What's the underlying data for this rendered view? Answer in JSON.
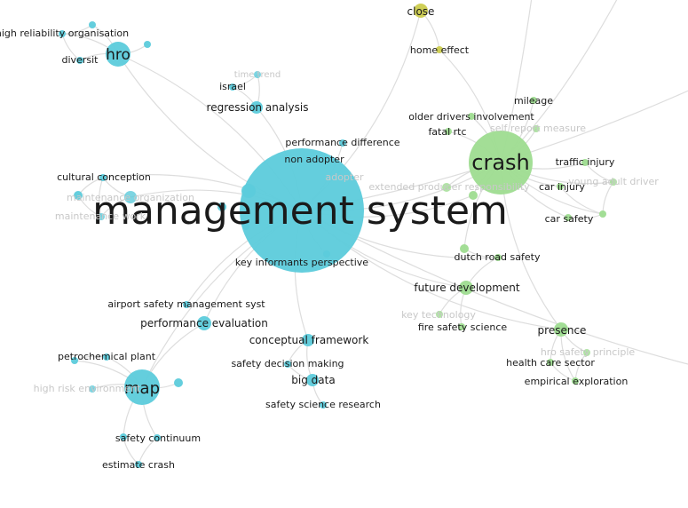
{
  "colors": {
    "cluster_cyan": "#5ccbdb",
    "cluster_green": "#9edc90",
    "cluster_yellow": "#cccc4e",
    "edge": "#dddddd",
    "label": "#1a1a1a",
    "label_faded": "#c8c8c8"
  },
  "nodes": [
    {
      "label": "management system",
      "cluster": "cyan"
    },
    {
      "label": "hro",
      "cluster": "cyan"
    },
    {
      "label": "high reliability organisation",
      "cluster": "cyan"
    },
    {
      "label": "",
      "cluster": "cyan"
    },
    {
      "label": "",
      "cluster": "cyan"
    },
    {
      "label": "diversit",
      "cluster": "cyan"
    },
    {
      "label": "time trend",
      "cluster": "cyan",
      "faded": true
    },
    {
      "label": "israel",
      "cluster": "cyan"
    },
    {
      "label": "regression analysis",
      "cluster": "cyan"
    },
    {
      "label": "performance difference",
      "cluster": "cyan"
    },
    {
      "label": "non adopter",
      "cluster": "cyan"
    },
    {
      "label": "adopter",
      "cluster": "cyan",
      "faded": true
    },
    {
      "label": "cultural conception",
      "cluster": "cyan"
    },
    {
      "label": "maintenance organization",
      "cluster": "cyan",
      "faded": true
    },
    {
      "label": "",
      "cluster": "cyan"
    },
    {
      "label": "maintenance work",
      "cluster": "cyan",
      "faded": true
    },
    {
      "label": "key informants perspective",
      "cluster": "cyan"
    },
    {
      "label": "",
      "cluster": "cyan"
    },
    {
      "label": "",
      "cluster": "cyan"
    },
    {
      "label": "",
      "cluster": "cyan"
    },
    {
      "label": "airport safety management syst",
      "cluster": "cyan"
    },
    {
      "label": "performance evaluation",
      "cluster": "cyan"
    },
    {
      "label": "conceptual framework",
      "cluster": "cyan"
    },
    {
      "label": "safety decision making",
      "cluster": "cyan"
    },
    {
      "label": "big data",
      "cluster": "cyan"
    },
    {
      "label": "safety science research",
      "cluster": "cyan"
    },
    {
      "label": "map",
      "cluster": "cyan"
    },
    {
      "label": "petrochemical plant",
      "cluster": "cyan"
    },
    {
      "label": "",
      "cluster": "cyan"
    },
    {
      "label": "",
      "cluster": "cyan"
    },
    {
      "label": "high risk environment",
      "cluster": "cyan",
      "faded": true
    },
    {
      "label": "safety continuum",
      "cluster": "cyan"
    },
    {
      "label": "",
      "cluster": "cyan"
    },
    {
      "label": "estimate crash",
      "cluster": "cyan"
    },
    {
      "label": "crash",
      "cluster": "green"
    },
    {
      "label": "close",
      "cluster": "yellow"
    },
    {
      "label": "home effect",
      "cluster": "yellow"
    },
    {
      "label": "mileage",
      "cluster": "green"
    },
    {
      "label": "older drivers involvement",
      "cluster": "green"
    },
    {
      "label": "self report measure",
      "cluster": "green",
      "faded": true
    },
    {
      "label": "fatal rtc",
      "cluster": "green"
    },
    {
      "label": "traffic injury",
      "cluster": "green"
    },
    {
      "label": "young adult driver",
      "cluster": "green",
      "faded": true
    },
    {
      "label": "extended producer responsibility",
      "cluster": "green",
      "faded": true
    },
    {
      "label": "",
      "cluster": "green"
    },
    {
      "label": "car injury",
      "cluster": "green"
    },
    {
      "label": "car safety",
      "cluster": "green"
    },
    {
      "label": "",
      "cluster": "green"
    },
    {
      "label": "",
      "cluster": "green"
    },
    {
      "label": "dutch road safety",
      "cluster": "green"
    },
    {
      "label": "future development",
      "cluster": "green"
    },
    {
      "label": "key technology",
      "cluster": "green",
      "faded": true
    },
    {
      "label": "fire safety science",
      "cluster": "green"
    },
    {
      "label": "presence",
      "cluster": "green"
    },
    {
      "label": "hro safety principle",
      "cluster": "green",
      "faded": true
    },
    {
      "label": "health care sector",
      "cluster": "green"
    },
    {
      "label": "empirical exploration",
      "cluster": "green"
    }
  ]
}
